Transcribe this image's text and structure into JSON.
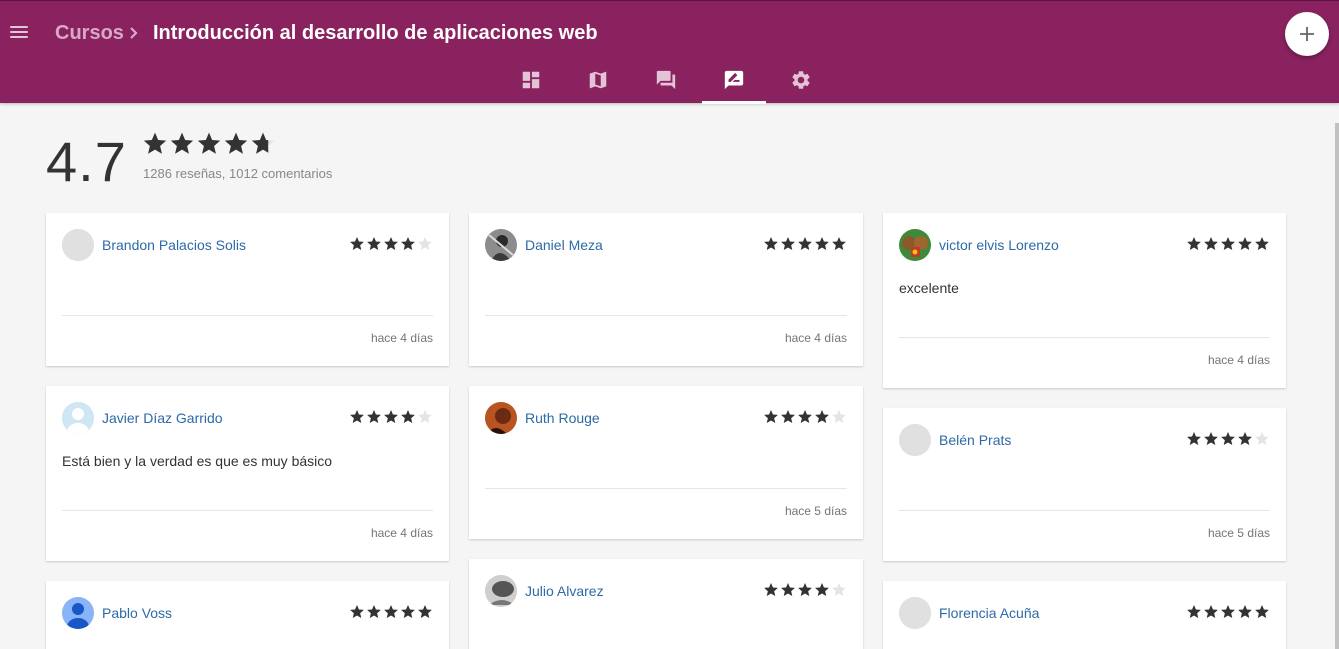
{
  "header": {
    "breadcrumb_root": "Cursos",
    "breadcrumb_sep": ">",
    "course_title": "Introducción al desarrollo de aplicaciones web",
    "add_button_icon": "plus-icon",
    "tabs": [
      {
        "icon": "dashboard-icon",
        "active": false
      },
      {
        "icon": "map-icon",
        "active": false
      },
      {
        "icon": "forum-icon",
        "active": false
      },
      {
        "icon": "rate-review-icon",
        "active": true
      },
      {
        "icon": "settings-gear-icon",
        "active": false
      }
    ],
    "colors": {
      "bar": "#8a2260",
      "accent": "#ffffff"
    }
  },
  "summary": {
    "score": "4.7",
    "rating": 4.7,
    "count_text": "1286 reseñas, 1012 comentarios"
  },
  "reviews": [
    {
      "name": "Brandon Palacios Solis",
      "rating": 4,
      "text": "",
      "date": "hace 4 días",
      "avatar": "placeholder"
    },
    {
      "name": "Daniel Meza",
      "rating": 5,
      "text": "",
      "date": "hace 4 días",
      "avatar": "photo-dark"
    },
    {
      "name": "victor elvis Lorenzo",
      "rating": 5,
      "text": "excelente",
      "date": "hace 4 días",
      "avatar": "photo-chipmunk"
    },
    {
      "name": "Javier Díaz Garrido",
      "rating": 4,
      "text": "Está bien y la verdad es que es muy básico",
      "date": "hace 4 días",
      "avatar": "default-user-light"
    },
    {
      "name": "Ruth Rouge",
      "rating": 4,
      "text": "",
      "date": "hace 5 días",
      "avatar": "photo-warm"
    },
    {
      "name": "Belén Prats",
      "rating": 4,
      "text": "",
      "date": "hace 5 días",
      "avatar": "placeholder"
    },
    {
      "name": "Pablo Voss",
      "rating": 5,
      "text": "",
      "date": "",
      "avatar": "default-user-blue"
    },
    {
      "name": "Julio Alvarez",
      "rating": 4,
      "text": "",
      "date": "",
      "avatar": "photo-gray"
    },
    {
      "name": "Florencia Acuña",
      "rating": 5,
      "text": "",
      "date": "",
      "avatar": "placeholder"
    }
  ]
}
